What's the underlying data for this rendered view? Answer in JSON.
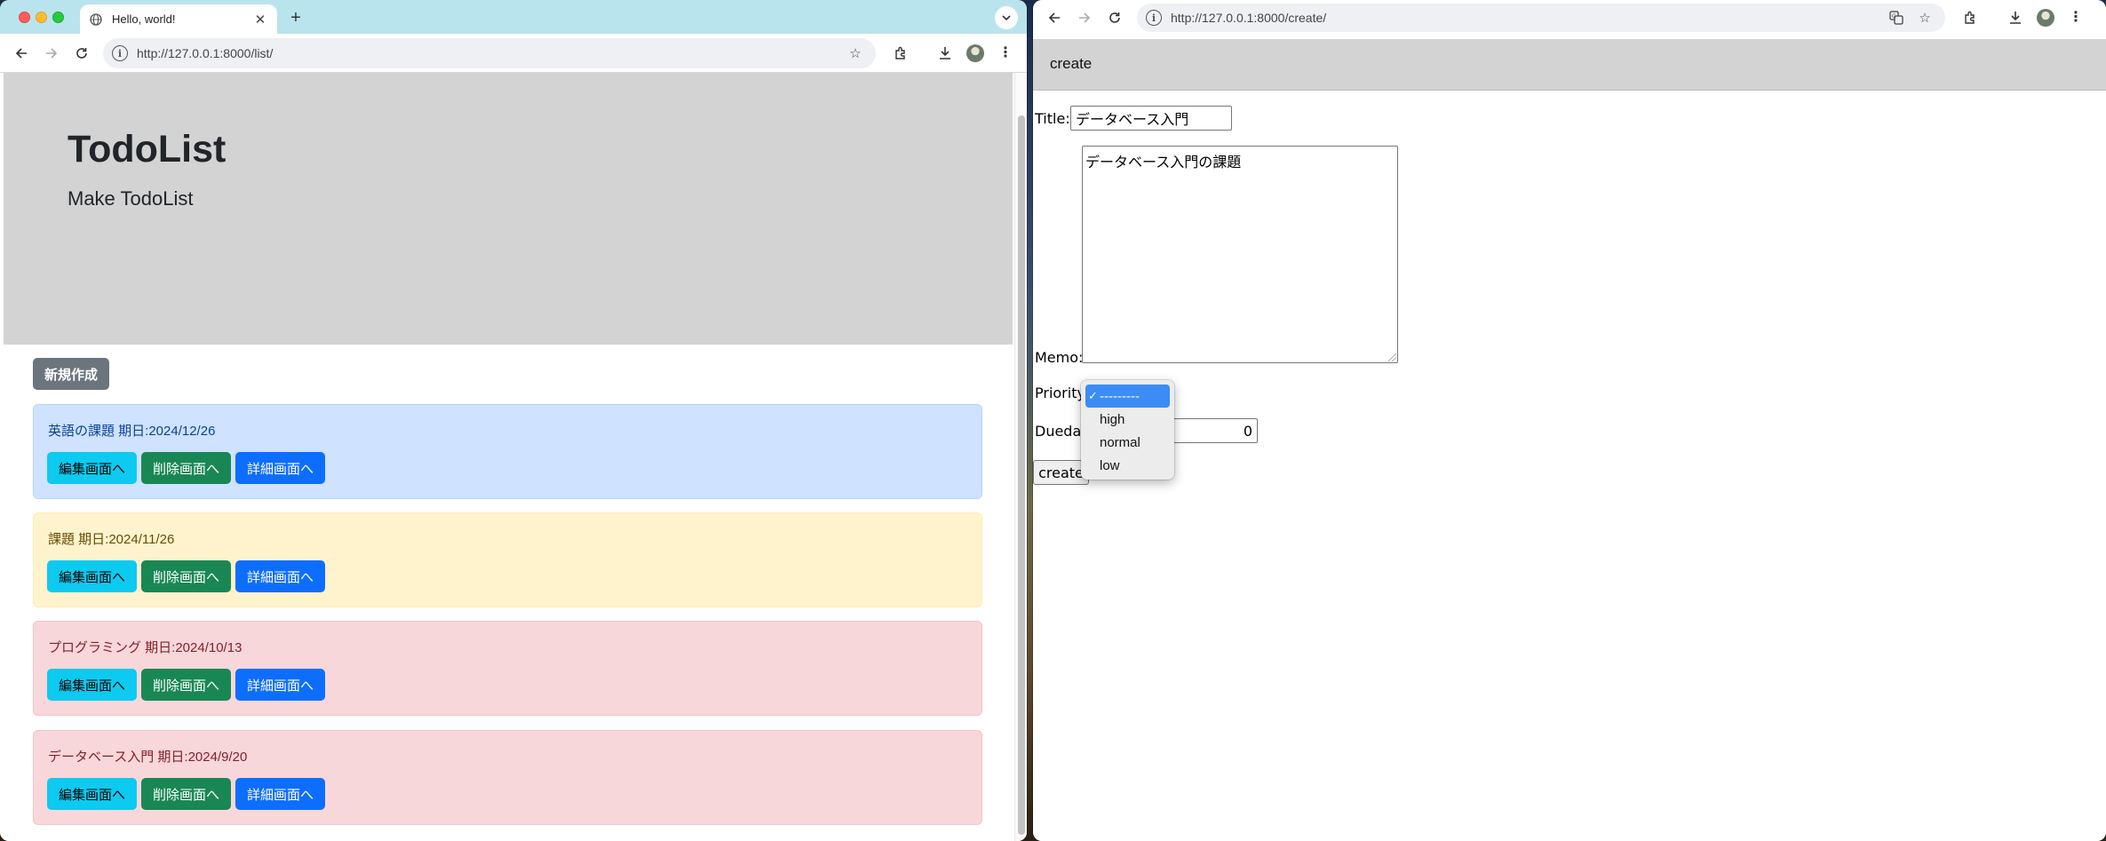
{
  "left_window": {
    "tab": {
      "title": "Hello, world!",
      "icon": "globe-icon"
    },
    "url": "http://127.0.0.1:8000/list/",
    "hero": {
      "title": "TodoList",
      "subtitle": "Make TodoList"
    },
    "new_button": "新規作成",
    "cards": [
      {
        "text": "英語の課題 期日:2024/12/26",
        "style": "primary"
      },
      {
        "text": "課題 期日:2024/11/26",
        "style": "warning"
      },
      {
        "text": "プログラミング 期日:2024/10/13",
        "style": "danger"
      },
      {
        "text": "データベース入門 期日:2024/9/20",
        "style": "danger"
      }
    ],
    "card_buttons": {
      "edit": "編集画面へ",
      "delete": "削除画面へ",
      "detail": "詳細画面へ"
    }
  },
  "right_window": {
    "url": "http://127.0.0.1:8000/create/",
    "nav_link": "create",
    "form": {
      "title_label": "Title:",
      "title_value": "データベース入門",
      "memo_label": "Memo:",
      "memo_value": "データベース入門の課題",
      "priority_label": "Priority",
      "duedate_label": "Duedat",
      "duedate_visible_value": "0",
      "submit_label": "create"
    },
    "priority_options": [
      {
        "label": "---------",
        "selected": true
      },
      {
        "label": "high",
        "selected": false
      },
      {
        "label": "normal",
        "selected": false
      },
      {
        "label": "low",
        "selected": false
      }
    ]
  },
  "colors": {
    "tabbar": "#b9e4ee",
    "hero_bg": "#d3d3d3",
    "btn_secondary": "#6c757d",
    "btn_info": "#0dcaf0",
    "btn_success": "#198754",
    "btn_primary": "#0d6efd",
    "dropdown_highlight": "#3b8cf6"
  }
}
